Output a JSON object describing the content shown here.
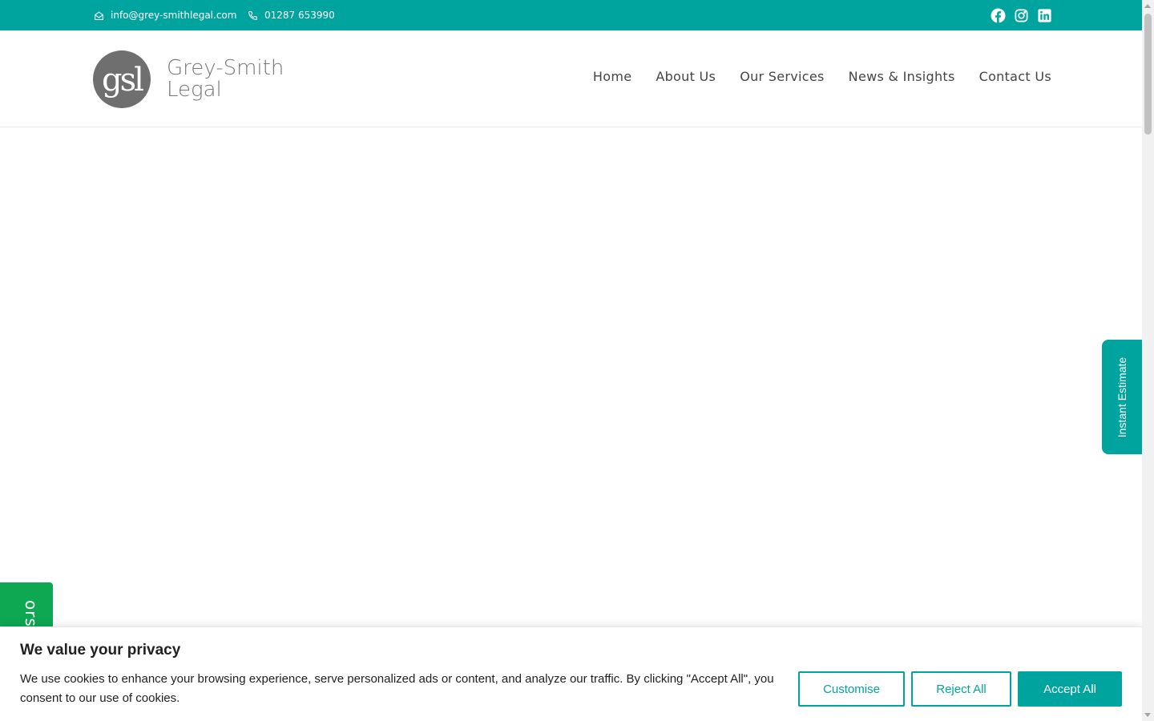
{
  "topbar": {
    "email": "info@grey-smithlegal.com",
    "phone": "01287 653990",
    "socials": [
      "facebook-icon",
      "instagram-icon",
      "linkedin-icon"
    ]
  },
  "logo": {
    "mark": "gsl",
    "line1": "Grey-Smith",
    "line2": "Legal"
  },
  "nav": {
    "items": [
      {
        "label": "Home"
      },
      {
        "label": "About Us"
      },
      {
        "label": "Our Services"
      },
      {
        "label": "News & Insights"
      },
      {
        "label": "Contact Us"
      }
    ]
  },
  "side_tabs": {
    "instant_estimate": "Instant Estimate",
    "left_tab_visible_text": "ors"
  },
  "cookie": {
    "title": "We value your privacy",
    "text": "We use cookies to enhance your browsing experience, serve personalized ads or content, and analyze our traffic. By clicking \"Accept All\", you consent to our use of cookies.",
    "customise_label": "Customise",
    "reject_label": "Reject All",
    "accept_label": "Accept All"
  },
  "colors": {
    "brand_teal": "#00a49f",
    "left_tab_green": "#0ea752",
    "logo_grey": "#6f6f6f"
  }
}
